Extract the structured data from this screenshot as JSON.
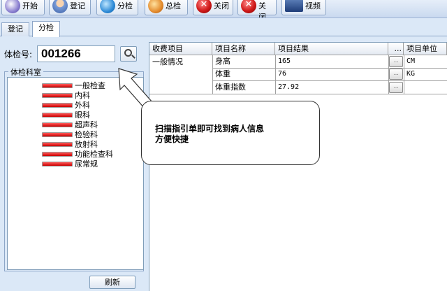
{
  "toolbar": {
    "start_label": "开始",
    "register_label": "登记",
    "subexam_label": "分检",
    "summary_label": "总检",
    "close_label": "关闭",
    "close_all_label": "全关闭",
    "video_label": "视频"
  },
  "tabs": [
    {
      "label": "登记",
      "active": false
    },
    {
      "label": "分检",
      "active": true
    }
  ],
  "exam_no": {
    "label": "体检号:",
    "value": "001266"
  },
  "departments": {
    "legend": "体检科室",
    "items": [
      "一般检查",
      "内科",
      "外科",
      "眼科",
      "超声科",
      "检验科",
      "放射科",
      "功能检查科",
      "尿常规"
    ]
  },
  "refresh_label": "刷新",
  "grid": {
    "headers": {
      "fee_item": "收费项目",
      "item_name": "项目名称",
      "result": "项目结果",
      "ellipsis": "...",
      "unit": "项目单位"
    },
    "group": "一般情况",
    "rows": [
      {
        "name": "身高",
        "result": "165",
        "btn": "..",
        "unit": "CM"
      },
      {
        "name": "体重",
        "result": "76",
        "btn": "..",
        "unit": "KG"
      },
      {
        "name": "体重指数",
        "result": "27.92",
        "btn": "..",
        "unit": ""
      }
    ]
  },
  "callout": {
    "line1": "扫描指引单即可找到病人信息",
    "line2": "方便快捷"
  },
  "colors": {
    "background": "#dbe8f7",
    "bar_red": "#e00000",
    "border": "#7f9db9"
  }
}
